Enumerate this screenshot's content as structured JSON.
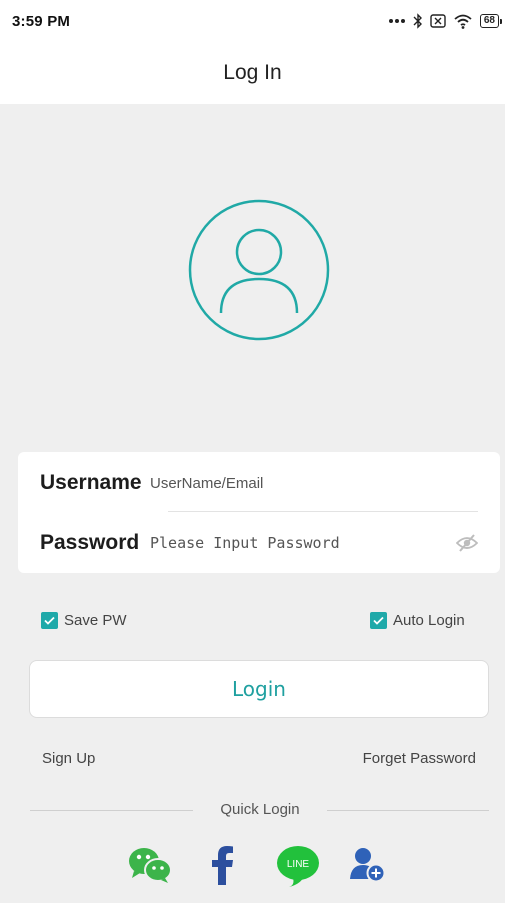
{
  "status_bar": {
    "time": "3:59 PM",
    "battery": "68"
  },
  "header": {
    "title": "Log In"
  },
  "form": {
    "username_label": "Username",
    "username_placeholder": "UserName/Email",
    "password_label": "Password",
    "password_placeholder": "Please Input Password"
  },
  "options": {
    "save_pw": "Save PW",
    "auto_login": "Auto Login"
  },
  "login_button": "Login",
  "links": {
    "sign_up": "Sign Up",
    "forget_password": "Forget Password"
  },
  "quick_login": {
    "label": "Quick Login",
    "line_label": "LINE",
    "providers": [
      "wechat-icon",
      "facebook-icon",
      "line-icon",
      "add-user-icon"
    ]
  },
  "colors": {
    "accent": "#1fa9a9",
    "wechat": "#3cb44a",
    "facebook": "#2c4f9e",
    "line": "#22c13c",
    "adduser": "#2f62b8"
  }
}
